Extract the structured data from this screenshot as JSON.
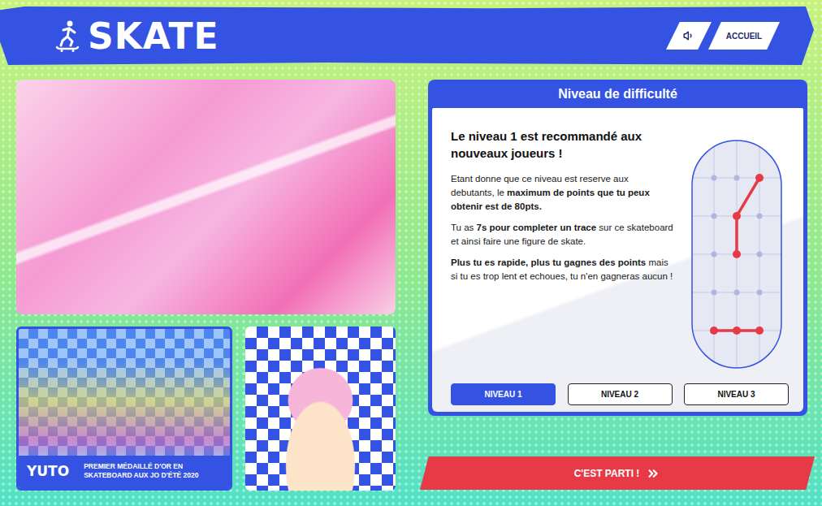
{
  "header": {
    "title": "SKATE",
    "nav": [
      "ACCUEIL"
    ]
  },
  "athlete": {
    "name": "YUTO",
    "caption": "PREMIER MÉDAILLÉ D'OR EN SKATEBOARD AUX JO D'ÉTÉ 2020"
  },
  "difficulty": {
    "title": "Niveau de difficulté",
    "heading": "Le niveau 1 est recommandé aux nouveaux joueurs !",
    "paragraphs": [
      [
        {
          "text": "Etant donne que ce niveau est reserve aux debutants, le ",
          "bold": false
        },
        {
          "text": "maximum de points que tu peux obtenir est de 80pts.",
          "bold": true
        }
      ],
      [
        {
          "text": "Tu as ",
          "bold": false
        },
        {
          "text": "7s pour completer un trace",
          "bold": true
        },
        {
          "text": " sur ce skateboard et ainsi faire une figure de skate.",
          "bold": false
        }
      ],
      [
        {
          "text": "Plus tu es rapide, plus tu gagnes des points",
          "bold": true
        },
        {
          "text": " mais si tu es trop lent et echoues, tu n'en gagneras aucun !",
          "bold": false
        }
      ]
    ]
  },
  "board": {
    "columns": 3,
    "rows": 5,
    "trace": [
      [
        2,
        0
      ],
      [
        1,
        1
      ],
      [
        1,
        2
      ]
    ],
    "sample": [
      [
        0,
        4
      ],
      [
        1,
        4
      ],
      [
        2,
        4
      ]
    ]
  },
  "levels": [
    {
      "label": "NIVEAU 1",
      "selected": true
    },
    {
      "label": "NIVEAU 2",
      "selected": false
    },
    {
      "label": "NIVEAU 3",
      "selected": false
    }
  ],
  "start_button": {
    "label": "C'EST PARTI !"
  }
}
